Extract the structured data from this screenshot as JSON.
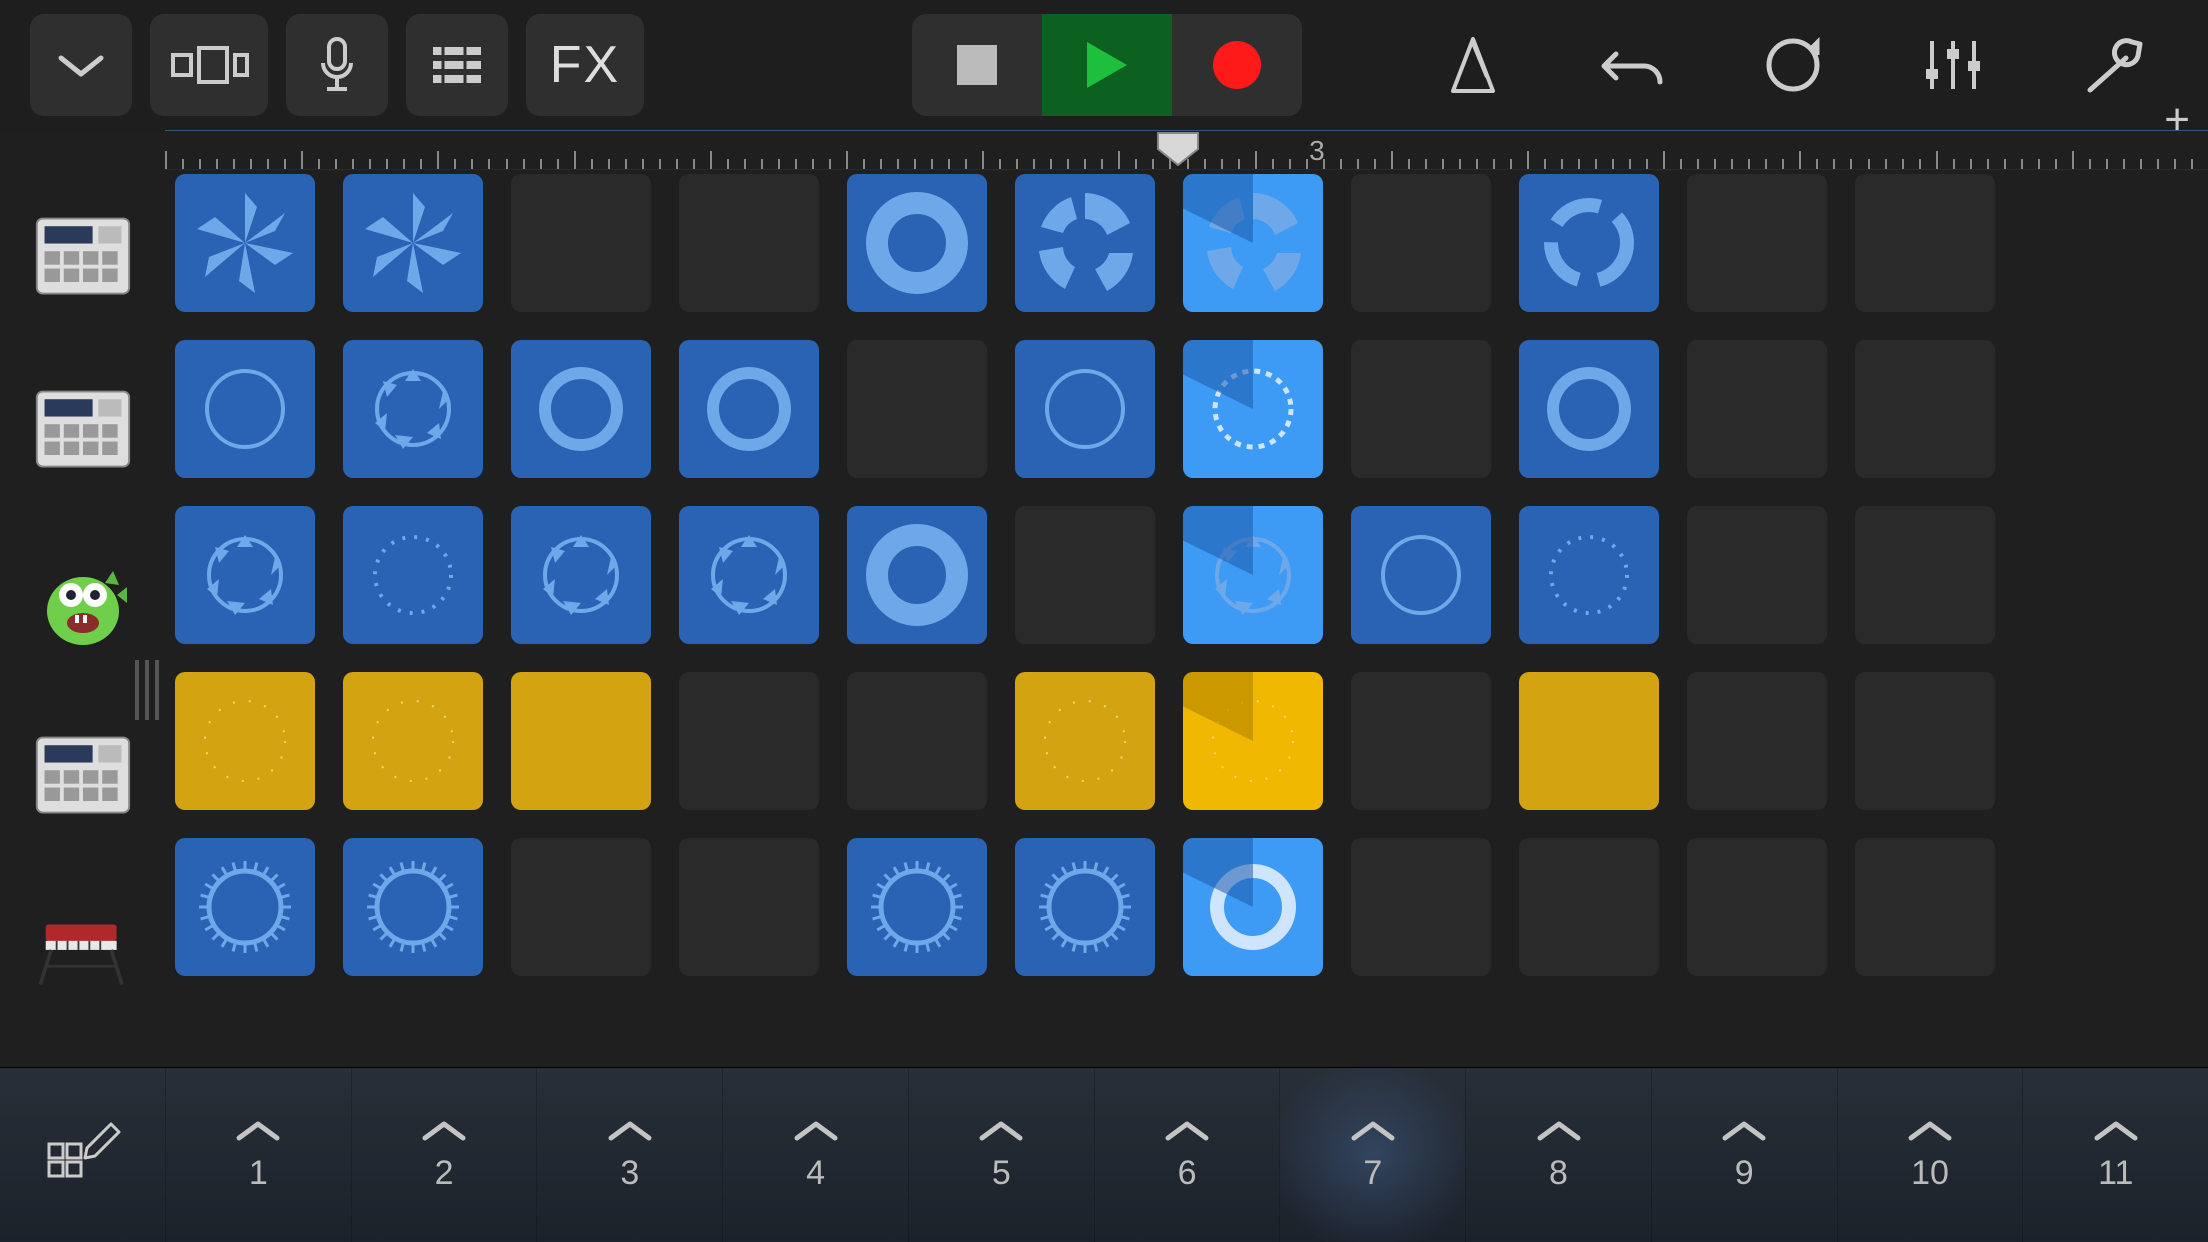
{
  "toolbar": {
    "fx_label": "FX"
  },
  "timeline": {
    "playhead_position_pct": 48.5,
    "bar_markers": [
      {
        "label": "3",
        "pct": 56
      }
    ]
  },
  "tracks": [
    {
      "name": "drum-machine-1",
      "icon": "drum-machine"
    },
    {
      "name": "drum-machine-2",
      "icon": "drum-machine"
    },
    {
      "name": "synth-monster",
      "icon": "monster"
    },
    {
      "name": "drum-machine-3",
      "icon": "drum-machine"
    },
    {
      "name": "keyboard",
      "icon": "keyboard"
    }
  ],
  "columns": [
    "1",
    "2",
    "3",
    "4",
    "5",
    "6",
    "7",
    "8",
    "9",
    "10",
    "11"
  ],
  "active_column_index": 6,
  "grid": [
    [
      {
        "t": "blue",
        "w": "burst"
      },
      {
        "t": "blue",
        "w": "burst"
      },
      {
        "t": "empty"
      },
      {
        "t": "empty"
      },
      {
        "t": "blue",
        "w": "wave-ring"
      },
      {
        "t": "blue",
        "w": "wave-seg"
      },
      {
        "t": "active-blue",
        "w": "wave-seg",
        "prog": true
      },
      {
        "t": "empty"
      },
      {
        "t": "blue",
        "w": "ring-gap"
      },
      {
        "t": "empty"
      },
      {
        "t": "empty"
      }
    ],
    [
      {
        "t": "blue",
        "w": "ring-thin"
      },
      {
        "t": "blue",
        "w": "ring-arrows"
      },
      {
        "t": "blue",
        "w": "ring-solid"
      },
      {
        "t": "blue",
        "w": "ring-solid"
      },
      {
        "t": "empty"
      },
      {
        "t": "blue",
        "w": "ring-thin"
      },
      {
        "t": "active-blue",
        "w": "ring-dash",
        "prog": true
      },
      {
        "t": "empty"
      },
      {
        "t": "blue",
        "w": "ring-solid"
      },
      {
        "t": "empty"
      },
      {
        "t": "empty"
      }
    ],
    [
      {
        "t": "blue",
        "w": "ring-arrows"
      },
      {
        "t": "blue",
        "w": "ring-dots"
      },
      {
        "t": "blue",
        "w": "ring-arrows"
      },
      {
        "t": "blue",
        "w": "ring-arrows"
      },
      {
        "t": "blue",
        "w": "wave-ring"
      },
      {
        "t": "empty"
      },
      {
        "t": "active-blue",
        "w": "ring-arrows",
        "prog": true
      },
      {
        "t": "blue",
        "w": "ring-thin"
      },
      {
        "t": "blue",
        "w": "ring-dots"
      },
      {
        "t": "empty"
      },
      {
        "t": "empty"
      }
    ],
    [
      {
        "t": "yellow",
        "w": "dots-sparse"
      },
      {
        "t": "yellow",
        "w": "dots-sparse"
      },
      {
        "t": "yellow",
        "w": "plain"
      },
      {
        "t": "empty"
      },
      {
        "t": "empty"
      },
      {
        "t": "yellow",
        "w": "dots-sparse"
      },
      {
        "t": "active-yellow",
        "w": "dots-sparse",
        "prog": true
      },
      {
        "t": "empty"
      },
      {
        "t": "yellow",
        "w": "plain"
      },
      {
        "t": "empty"
      },
      {
        "t": "empty"
      }
    ],
    [
      {
        "t": "blue",
        "w": "ring-spike"
      },
      {
        "t": "blue",
        "w": "ring-spike"
      },
      {
        "t": "empty"
      },
      {
        "t": "empty"
      },
      {
        "t": "blue",
        "w": "ring-spike"
      },
      {
        "t": "blue",
        "w": "ring-spike"
      },
      {
        "t": "active-blue",
        "w": "ring-wave",
        "prog": true
      },
      {
        "t": "empty"
      },
      {
        "t": "empty"
      },
      {
        "t": "empty"
      },
      {
        "t": "empty"
      }
    ]
  ]
}
